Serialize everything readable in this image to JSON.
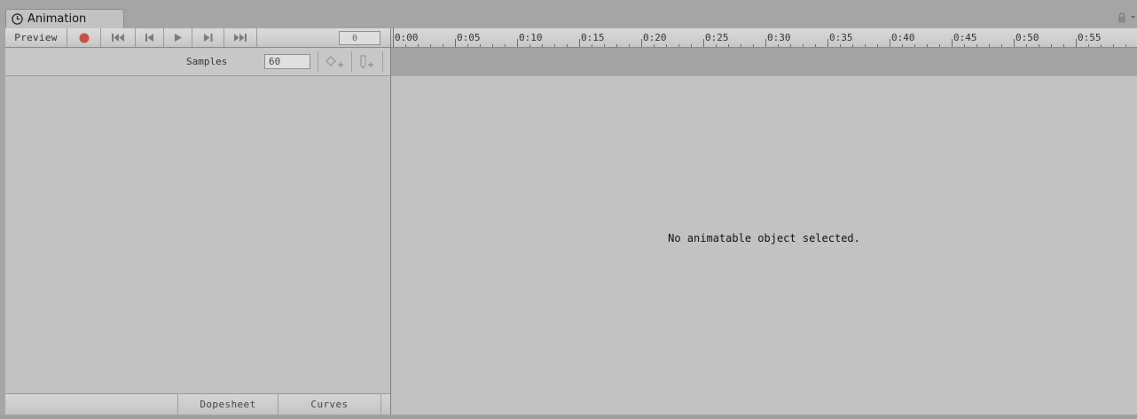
{
  "window": {
    "tab_title": "Animation",
    "icons": {
      "tab": "clock-icon",
      "lock": "lock-icon",
      "menu": "dropdown-caret-icon"
    }
  },
  "toolbar": {
    "preview_label": "Preview",
    "frame_value": "0",
    "record_color": "#c8504a",
    "controls": [
      "record-icon",
      "first-key-icon",
      "prev-key-icon",
      "play-icon",
      "next-key-icon",
      "last-key-icon"
    ]
  },
  "ruler": {
    "labels": [
      "0:00",
      "0:05",
      "0:10",
      "0:15",
      "0:20",
      "0:25",
      "0:30",
      "0:35",
      "0:40",
      "0:45",
      "0:50",
      "0:55"
    ]
  },
  "samples": {
    "label": "Samples",
    "value": "60",
    "icons": [
      "add-keyframe-icon",
      "add-event-icon"
    ]
  },
  "main": {
    "message": "No animatable object selected."
  },
  "bottom": {
    "tabs": [
      "Dopesheet",
      "Curves"
    ]
  }
}
